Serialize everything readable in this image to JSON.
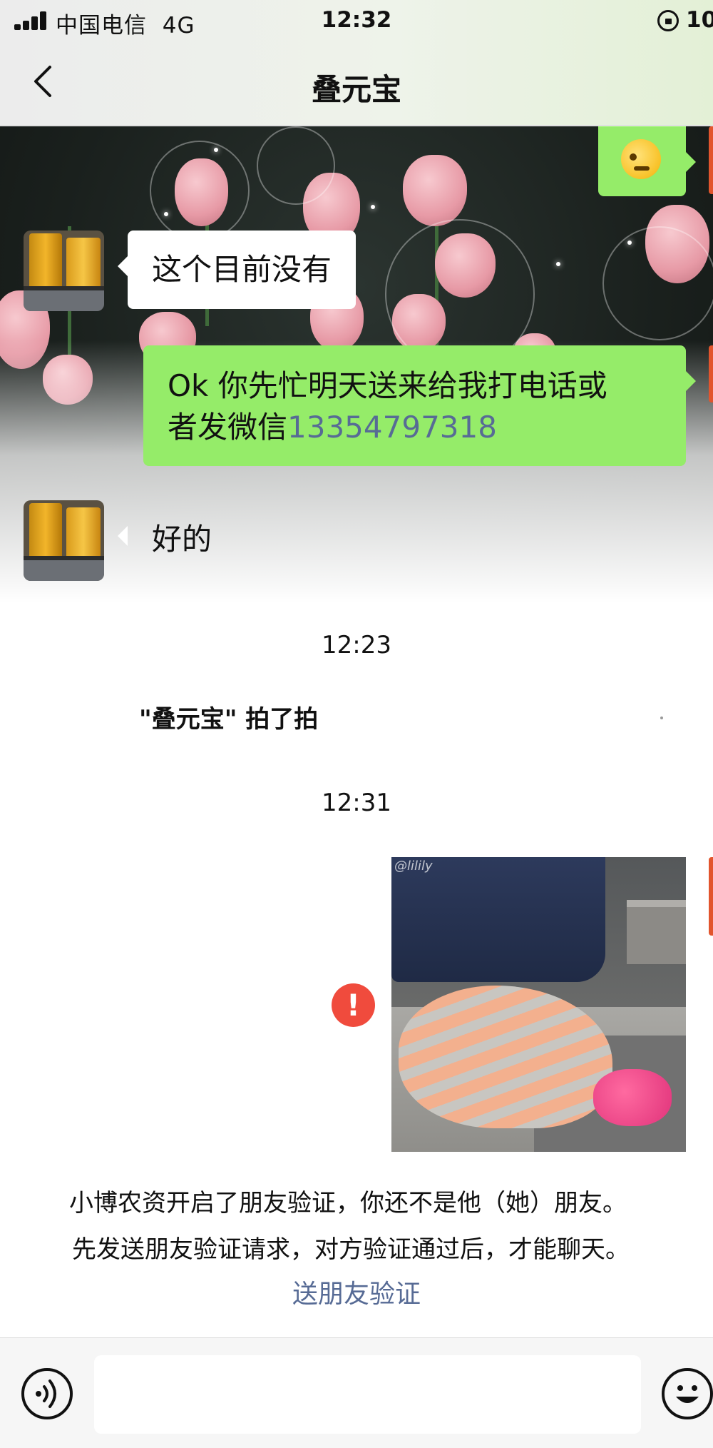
{
  "status_bar": {
    "carrier": "中国电信",
    "network": "4G",
    "time": "12:32",
    "battery": "10"
  },
  "nav": {
    "title": "叠元宝"
  },
  "messages": {
    "incoming_1": "这个目前没有",
    "outgoing_1": "Ok 你先忙明天送来给我打电话或者发微信",
    "outgoing_1_line1": "Ok 你先忙明天送来给我打电话或",
    "outgoing_1_line2_prefix": "者发微信",
    "outgoing_1_phone": "13354797318",
    "incoming_2": "好的"
  },
  "timestamps": {
    "first": "12:23",
    "second": "12:31"
  },
  "pat_notice": "\"叠元宝\" 拍了拍",
  "sent_image": {
    "watermark": "@lilily",
    "status": "failed"
  },
  "friend_notice": {
    "line1": "小博农资开启了朋友验证，你还不是他（她）朋友。",
    "line2": "先发送朋友验证请求，对方验证通过后，才能聊天。",
    "link": "送朋友验证"
  },
  "input": {
    "placeholder": ""
  },
  "icons": {
    "back": "chevron-left-icon",
    "voice": "voice-icon",
    "emoji": "smiley-icon",
    "error": "exclamation-icon"
  },
  "colors": {
    "outgoing_bubble": "#95ec69",
    "incoming_bubble": "#ffffff",
    "link": "#576b95",
    "error": "#f04b3d"
  }
}
